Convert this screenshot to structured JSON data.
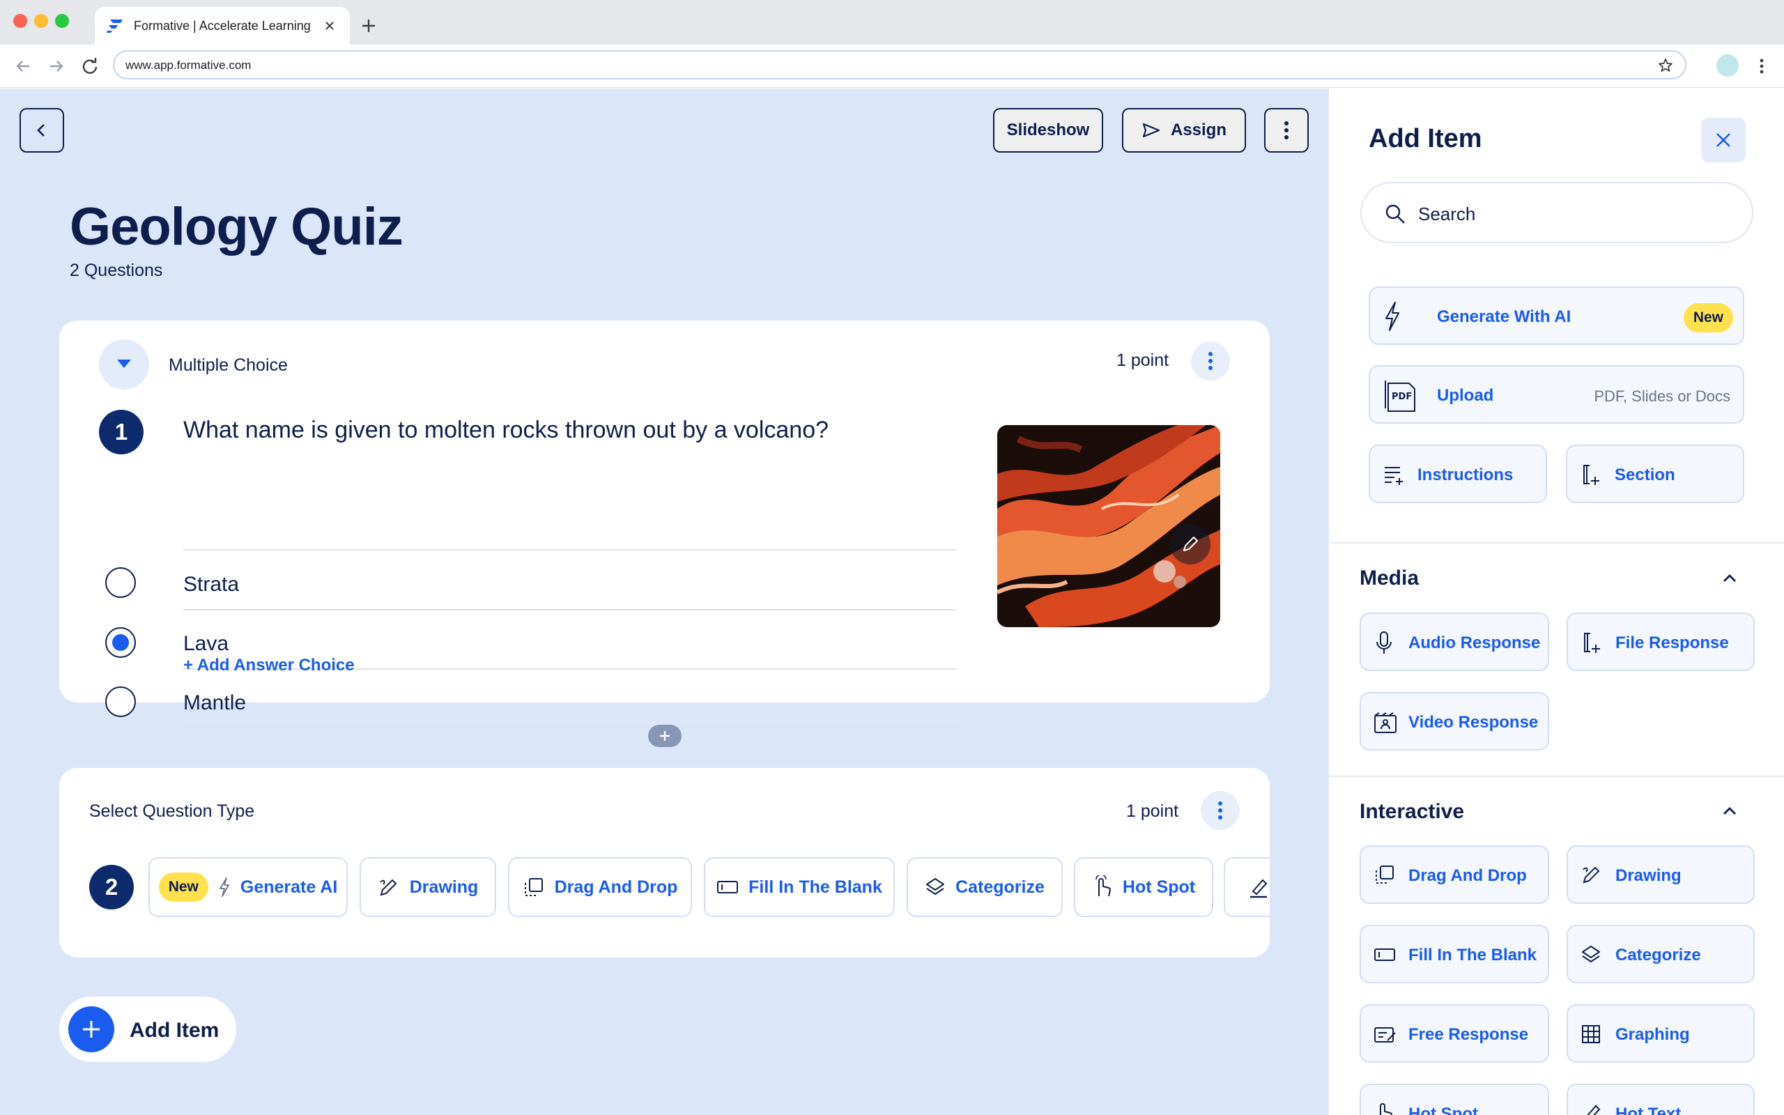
{
  "browser": {
    "tab_title": "Formative | Accelerate Learning",
    "url": "www.app.formative.com"
  },
  "header": {
    "slideshow_label": "Slideshow",
    "assign_label": "Assign"
  },
  "quiz": {
    "title": "Geology Quiz",
    "subtitle": "2 Questions"
  },
  "question1": {
    "type": "Multiple Choice",
    "points": "1 point",
    "number": "1",
    "text": "What name is given to molten rocks thrown out by a volcano?",
    "choices": [
      {
        "label": "Strata",
        "selected": false
      },
      {
        "label": "Lava",
        "selected": true
      },
      {
        "label": "Mantle",
        "selected": false
      }
    ],
    "add_choice": "+ Add Answer Choice"
  },
  "question2": {
    "select_label": "Select Question Type",
    "points": "1 point",
    "number": "2",
    "types": [
      {
        "label": "Generate AI",
        "badge": "New",
        "icon": "lightning-icon"
      },
      {
        "label": "Drawing",
        "icon": "pencil-scribble-icon"
      },
      {
        "label": "Drag And Drop",
        "icon": "drag-drop-icon"
      },
      {
        "label": "Fill In The Blank",
        "icon": "text-field-icon"
      },
      {
        "label": "Categorize",
        "icon": "layers-icon"
      },
      {
        "label": "Hot Spot",
        "icon": "pointer-hand-icon"
      },
      {
        "label": "",
        "icon": "highlighter-icon"
      }
    ]
  },
  "add_item": {
    "label": "Add Item"
  },
  "panel": {
    "title": "Add Item",
    "search_placeholder": "Search",
    "generate_ai": {
      "label": "Generate With AI",
      "badge": "New"
    },
    "upload": {
      "label": "Upload",
      "hint": "PDF, Slides or Docs"
    },
    "instructions": "Instructions",
    "section": "Section",
    "media": {
      "heading": "Media",
      "items": [
        "Audio Response",
        "File Response",
        "Video Response"
      ]
    },
    "interactive": {
      "heading": "Interactive",
      "items": [
        "Drag And Drop",
        "Drawing",
        "Fill In The Blank",
        "Categorize",
        "Free Response",
        "Graphing",
        "Hot Spot",
        "Hot Text"
      ]
    }
  },
  "colors": {
    "navy": "#0f1f4d",
    "accent_blue": "#1a5cf0",
    "canvas_bg": "#dbe6f9",
    "badge_yellow": "#ffe14d"
  }
}
